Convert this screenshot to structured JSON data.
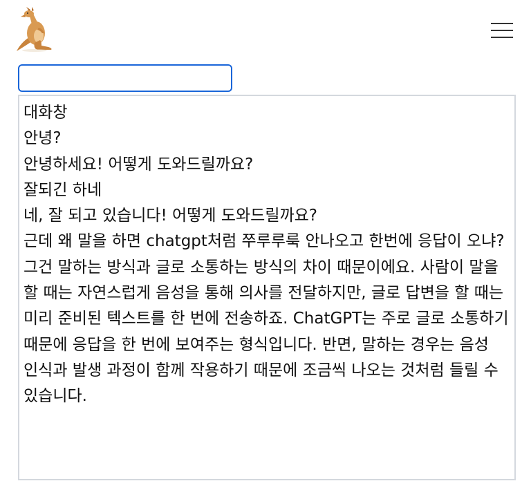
{
  "header": {
    "logo_icon": "kangaroo-icon",
    "menu_icon": "hamburger-menu-icon"
  },
  "search": {
    "value": "",
    "placeholder": ""
  },
  "chat": {
    "title": "대화창",
    "messages": [
      {
        "role": "user",
        "text": "안녕?"
      },
      {
        "role": "assistant",
        "text": "안녕하세요! 어떻게 도와드릴까요?"
      },
      {
        "role": "user",
        "text": "잘되긴 하네"
      },
      {
        "role": "assistant",
        "text": "네, 잘 되고 있습니다! 어떻게 도와드릴까요?"
      },
      {
        "role": "user",
        "text": "근데 왜 말을 하면 chatgpt처럼 쭈루루룩 안나오고 한번에 응답이 오냐?"
      },
      {
        "role": "assistant",
        "text": "그건 말하는 방식과 글로 소통하는 방식의 차이 때문이에요. 사람이 말을 할 때는 자연스럽게 음성을 통해 의사를 전달하지만, 글로 답변을 할 때는 미리 준비된 텍스트를 한 번에 전송하죠. ChatGPT는 주로 글로 소통하기 때문에 응답을 한 번에 보여주는 형식입니다. 반면, 말하는 경우는 음성 인식과 발생 과정이 함께 작용하기 때문에 조금씩 나오는 것처럼 들릴 수 있습니다."
      }
    ]
  }
}
